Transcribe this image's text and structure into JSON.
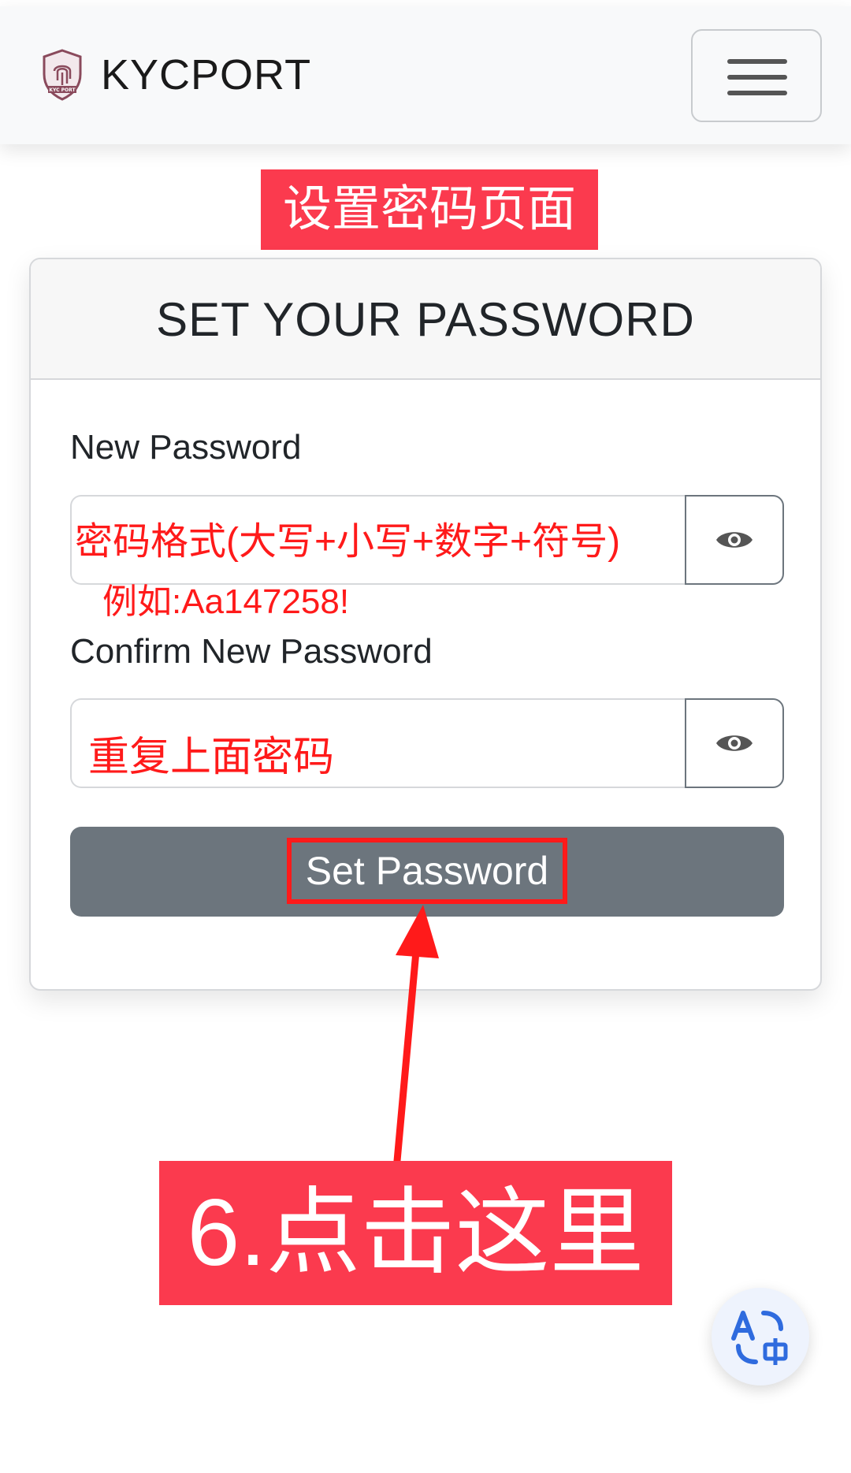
{
  "navbar": {
    "brand_name": "KYCPORT",
    "logo_text": "KYC PORT",
    "logo_icon": "fingerprint-shield-icon",
    "menu_icon": "hamburger-icon"
  },
  "annotations": {
    "page_title": "设置密码页面",
    "format_hint": "密码格式(大写+小写+数字+符号)",
    "example_hint": "例如:Aa147258!",
    "repeat_hint": "重复上面密码",
    "step": "6.点击这里",
    "highlight_color": "#fb3a4e",
    "hint_color": "#ff1a1a"
  },
  "card": {
    "title": "SET YOUR PASSWORD",
    "new_password_label": "New Password",
    "new_password_value": "",
    "confirm_password_label": "Confirm New Password",
    "confirm_password_value": "",
    "show_password_icon": "eye-icon",
    "submit_label": "Set Password",
    "submit_color": "#6c757d"
  },
  "fab": {
    "icon": "translate-icon"
  }
}
